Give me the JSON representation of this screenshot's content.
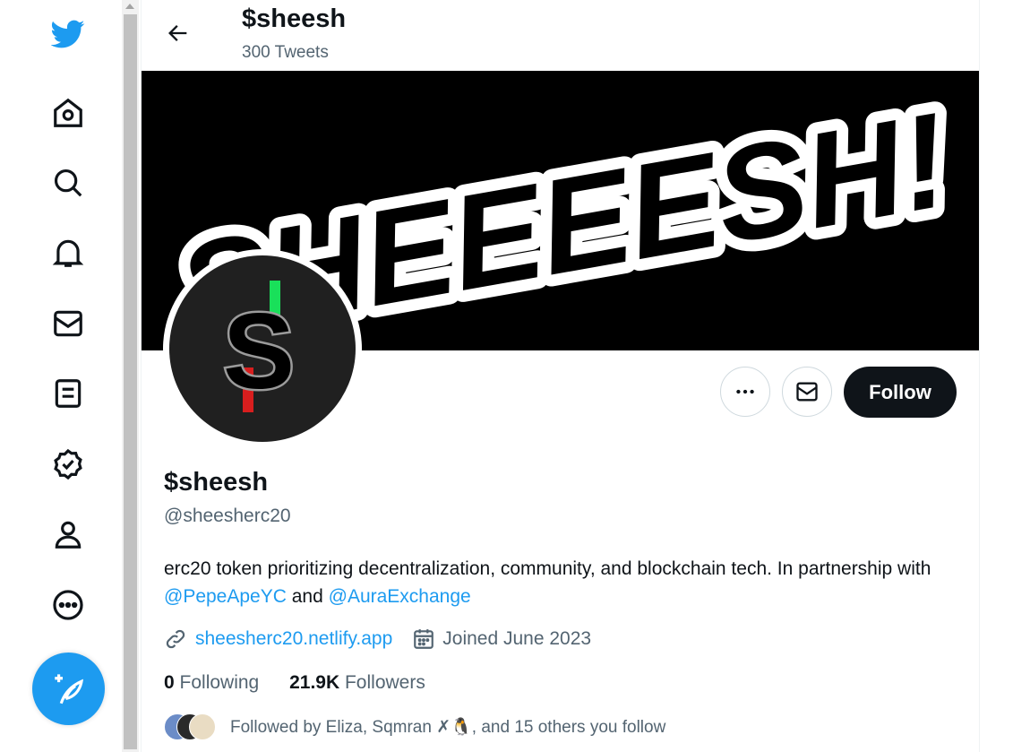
{
  "header": {
    "name": "$sheesh",
    "tweet_count": "300 Tweets"
  },
  "banner": {
    "text": "SHEEEESH!"
  },
  "profile": {
    "display_name": "$sheesh",
    "handle": "@sheesherc20",
    "bio_text": "erc20 token prioritizing decentralization, community, and blockchain tech. In partnership with ",
    "bio_mention_1": "@PepeApeYC",
    "bio_and": " and ",
    "bio_mention_2": "@AuraExchange",
    "website": "sheesherc20.netlify.app",
    "joined": "Joined June 2023",
    "following_count": "0",
    "following_label": "Following",
    "followers_count": "21.9K",
    "followers_label": "Followers",
    "followed_by": "Followed by Eliza, Sqmran ✗🐧, and 15 others you follow"
  },
  "actions": {
    "follow_label": "Follow"
  },
  "sidebar": {
    "items": [
      {
        "icon": "twitter-logo-icon"
      },
      {
        "icon": "home-icon"
      },
      {
        "icon": "search-icon"
      },
      {
        "icon": "bell-icon"
      },
      {
        "icon": "mail-icon"
      },
      {
        "icon": "lists-icon"
      },
      {
        "icon": "verified-icon"
      },
      {
        "icon": "profile-icon"
      },
      {
        "icon": "more-icon"
      }
    ],
    "compose_icon": "compose-tweet-icon"
  },
  "colors": {
    "accent": "#1d9bf0",
    "text": "#0f1419",
    "secondary": "#536471"
  }
}
